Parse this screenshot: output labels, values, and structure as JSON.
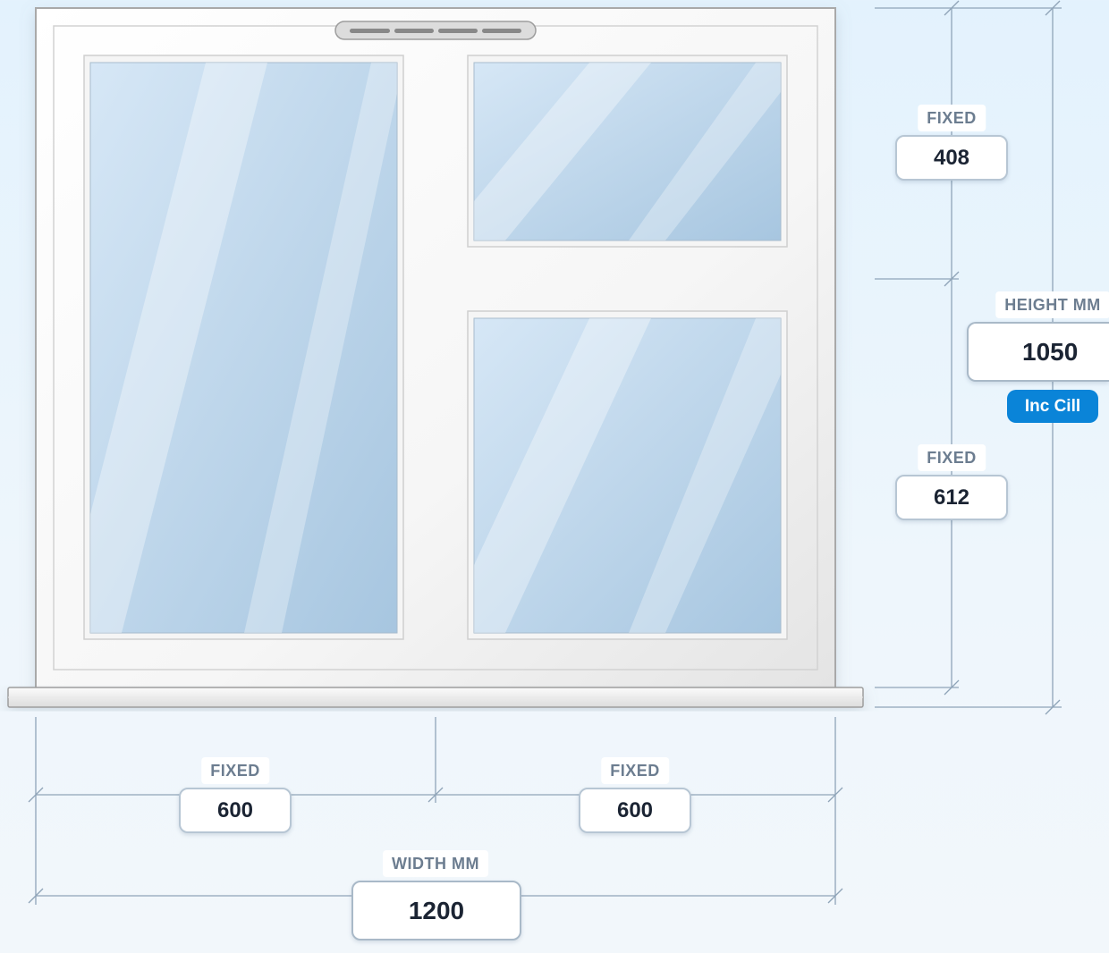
{
  "window": {
    "type": "two-column, right column split into two fixed panes",
    "frame_color": "#f7f7f7",
    "glass_color": "#b9d3ea"
  },
  "dimensions": {
    "height": {
      "label": "HEIGHT MM",
      "value": "1050",
      "badge": "Inc Cill"
    },
    "height_sections": [
      {
        "label": "FIXED",
        "value": "408"
      },
      {
        "label": "FIXED",
        "value": "612"
      }
    ],
    "width": {
      "label": "WIDTH MM",
      "value": "1200"
    },
    "width_sections": [
      {
        "label": "FIXED",
        "value": "600"
      },
      {
        "label": "FIXED",
        "value": "600"
      }
    ]
  },
  "colors": {
    "dimension_line": "#8fa4b8",
    "badge": "#0a84d8",
    "text": "#1b2433",
    "label_text": "#6c7d90"
  }
}
